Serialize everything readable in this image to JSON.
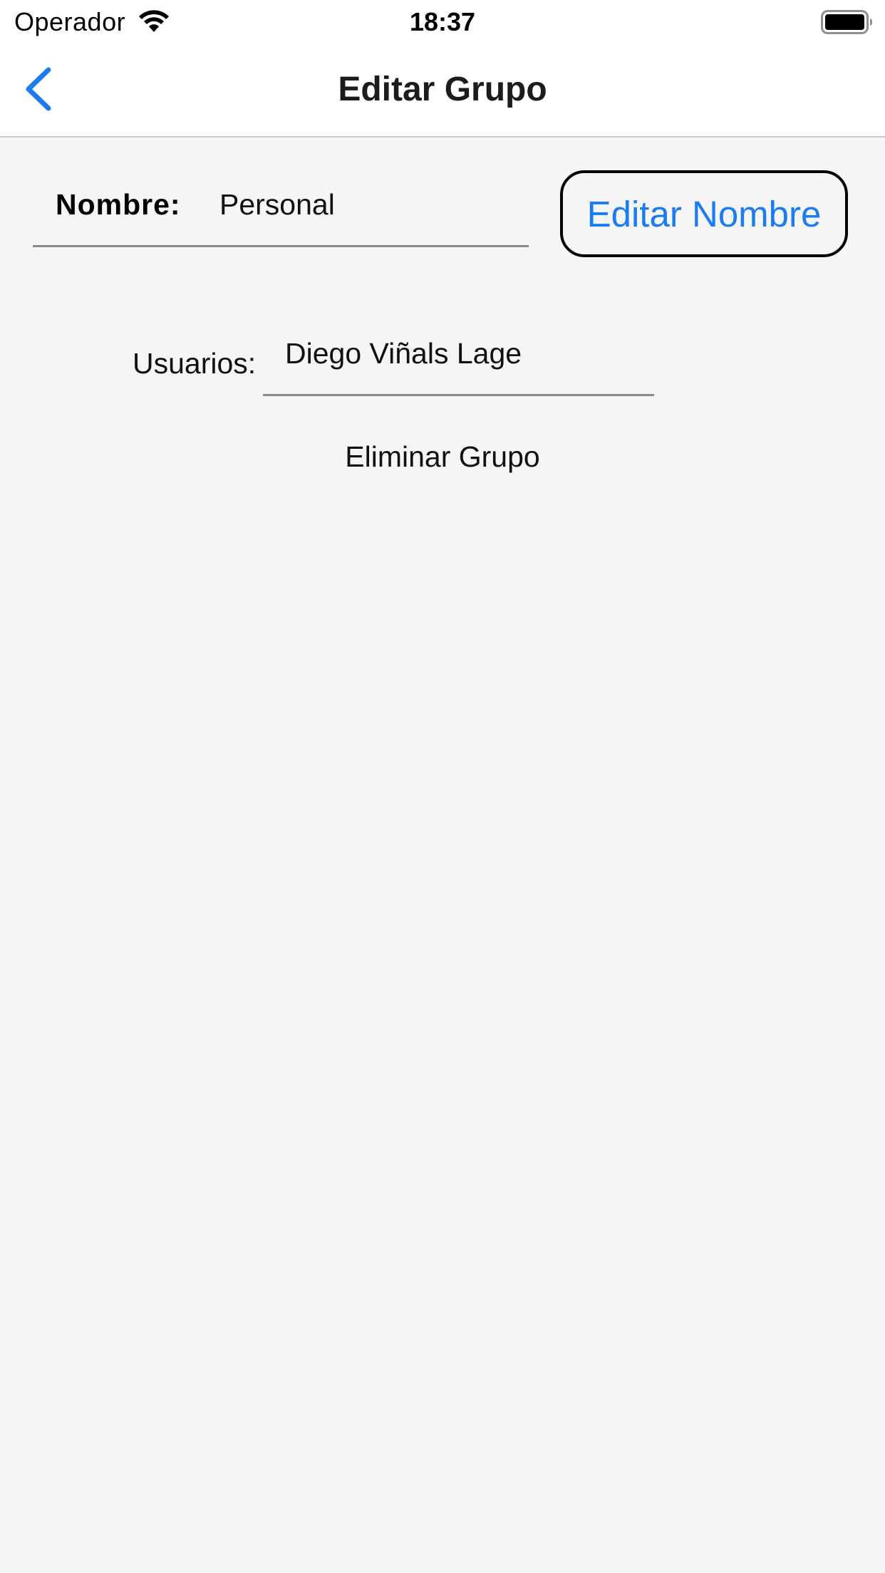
{
  "status_bar": {
    "carrier": "Operador",
    "time": "18:37",
    "wifi_icon": "wifi-icon",
    "battery_icon": "battery-icon"
  },
  "nav_bar": {
    "title": "Editar Grupo",
    "back_icon": "chevron-left-icon"
  },
  "form": {
    "name_label": "Nombre:",
    "name_value": "Personal",
    "edit_name_button": "Editar Nombre",
    "users_label": "Usuarios:",
    "users_value": "Diego Viñals Lage",
    "delete_group_button": "Eliminar Grupo"
  },
  "colors": {
    "accent": "#1a7cf0",
    "background": "#f5f5f5",
    "bar_background": "#ffffff"
  }
}
